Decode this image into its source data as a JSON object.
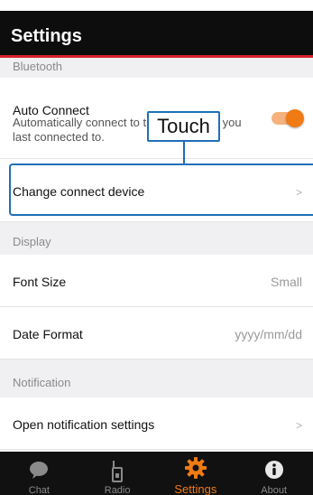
{
  "header": {
    "title": "Settings"
  },
  "sections": {
    "bluetooth": {
      "header": "Bluetooth",
      "auto_connect": {
        "label": "Auto Connect",
        "description_line1": "Automatically connect to the device that you",
        "description_line2": "last connected to.",
        "enabled": true
      },
      "change_device": {
        "label": "Change connect device",
        "chevron": ">"
      }
    },
    "display": {
      "header": "Display",
      "font_size": {
        "label": "Font Size",
        "value": "Small"
      },
      "date_format": {
        "label": "Date Format",
        "value": "yyyy/mm/dd"
      }
    },
    "notification": {
      "header": "Notification",
      "open_settings": {
        "label": "Open notification settings",
        "chevron": ">"
      }
    }
  },
  "callout": {
    "text": "Touch"
  },
  "tabbar": {
    "tabs": [
      {
        "label": "Chat",
        "icon": "chat-bubble-icon",
        "active": false
      },
      {
        "label": "Radio",
        "icon": "radio-icon",
        "active": false
      },
      {
        "label": "Settings",
        "icon": "gear-icon",
        "active": true
      },
      {
        "label": "About",
        "icon": "info-icon",
        "active": false
      }
    ]
  },
  "colors": {
    "accent": "#f07b14",
    "header_bg": "#0d0d0d",
    "header_underline": "#d8232a",
    "callout_blue": "#1f6fb8"
  }
}
